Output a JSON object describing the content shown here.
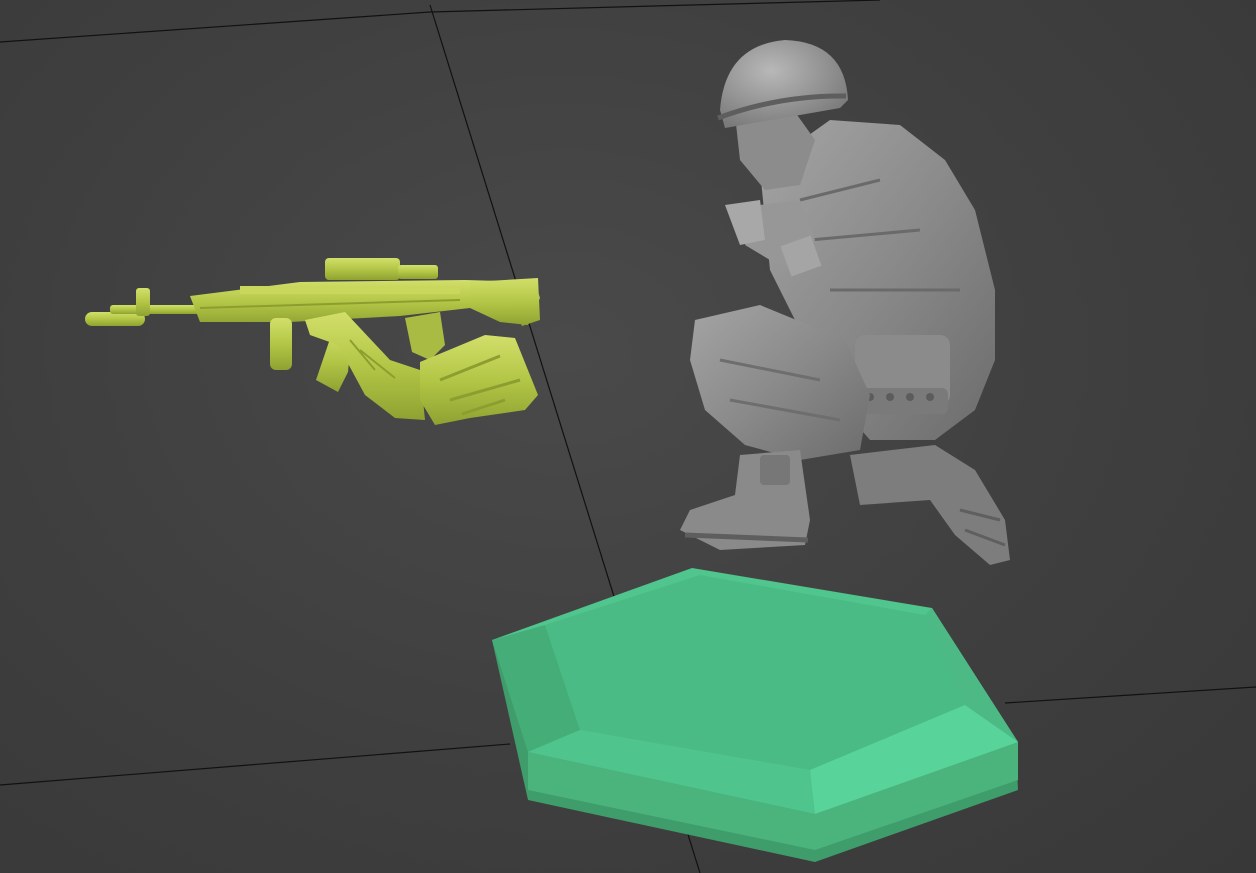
{
  "viewport": {
    "background_color": "#424242",
    "grid_line_color": "#111111"
  },
  "objects": [
    {
      "name": "rifle-with-arms",
      "color": "#b6c84a",
      "selected": false
    },
    {
      "name": "crouching-soldier",
      "color": "#8e8e8e",
      "selected": false
    },
    {
      "name": "hexagonal-base",
      "color": "#4ec28a",
      "selected": false
    }
  ]
}
